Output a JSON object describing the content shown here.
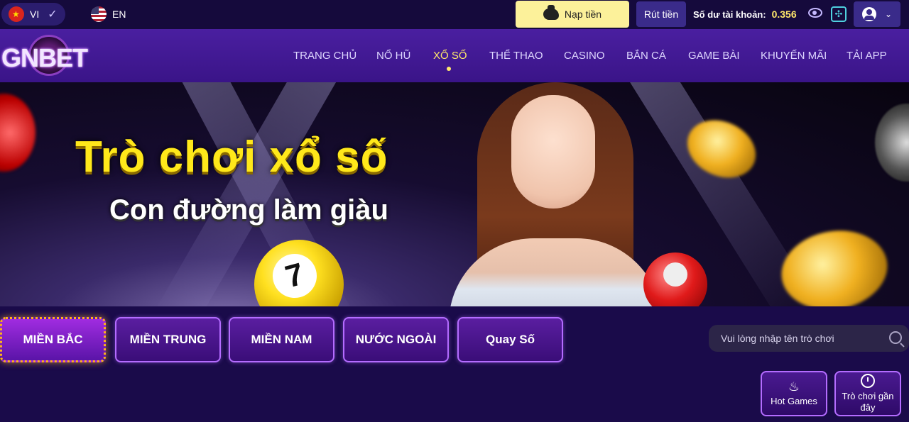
{
  "topbar": {
    "lang_vi": "VI",
    "lang_en": "EN",
    "deposit_label": "Nạp tiền",
    "withdraw_label": "Rút tiền",
    "balance_label": "Số dư tài khoản:",
    "balance_value": "0.356",
    "icons": [
      "vietnam-flag-icon",
      "check-icon",
      "us-flag-icon",
      "piggy-bank-icon",
      "eye-icon",
      "refresh-icon",
      "avatar-icon",
      "chevron-down-icon"
    ]
  },
  "brand": {
    "logo_text": "GNBET"
  },
  "nav": {
    "items": [
      "TRANG CHỦ",
      "NỔ HŨ",
      "XỔ SỐ",
      "THỂ THAO",
      "CASINO",
      "BẮN CÁ",
      "GAME BÀI",
      "KHUYẾN MÃI",
      "TẢI APP"
    ],
    "active": "XỔ SỐ"
  },
  "banner": {
    "headline": "Trò chơi xổ số",
    "subline": "Con đường làm giàu",
    "ball_number": "7"
  },
  "categories": {
    "items": [
      "MIỀN BẮC",
      "MIỀN TRUNG",
      "MIỀN NAM",
      "NƯỚC NGOÀI",
      "Quay Số"
    ],
    "active": "MIỀN BẮC"
  },
  "search": {
    "placeholder": "Vui lòng nhập tên trò chơi"
  },
  "quick_links": {
    "hot_games": "Hot Games",
    "recent_games": "Trò chơi gần đây"
  },
  "colors": {
    "accent_yellow": "#ffe86b",
    "deposit_bg": "#fcf19a",
    "nav_bg": "#4a1fa0",
    "page_bg": "#1a0b4a",
    "tab_border": "#b46cff"
  }
}
